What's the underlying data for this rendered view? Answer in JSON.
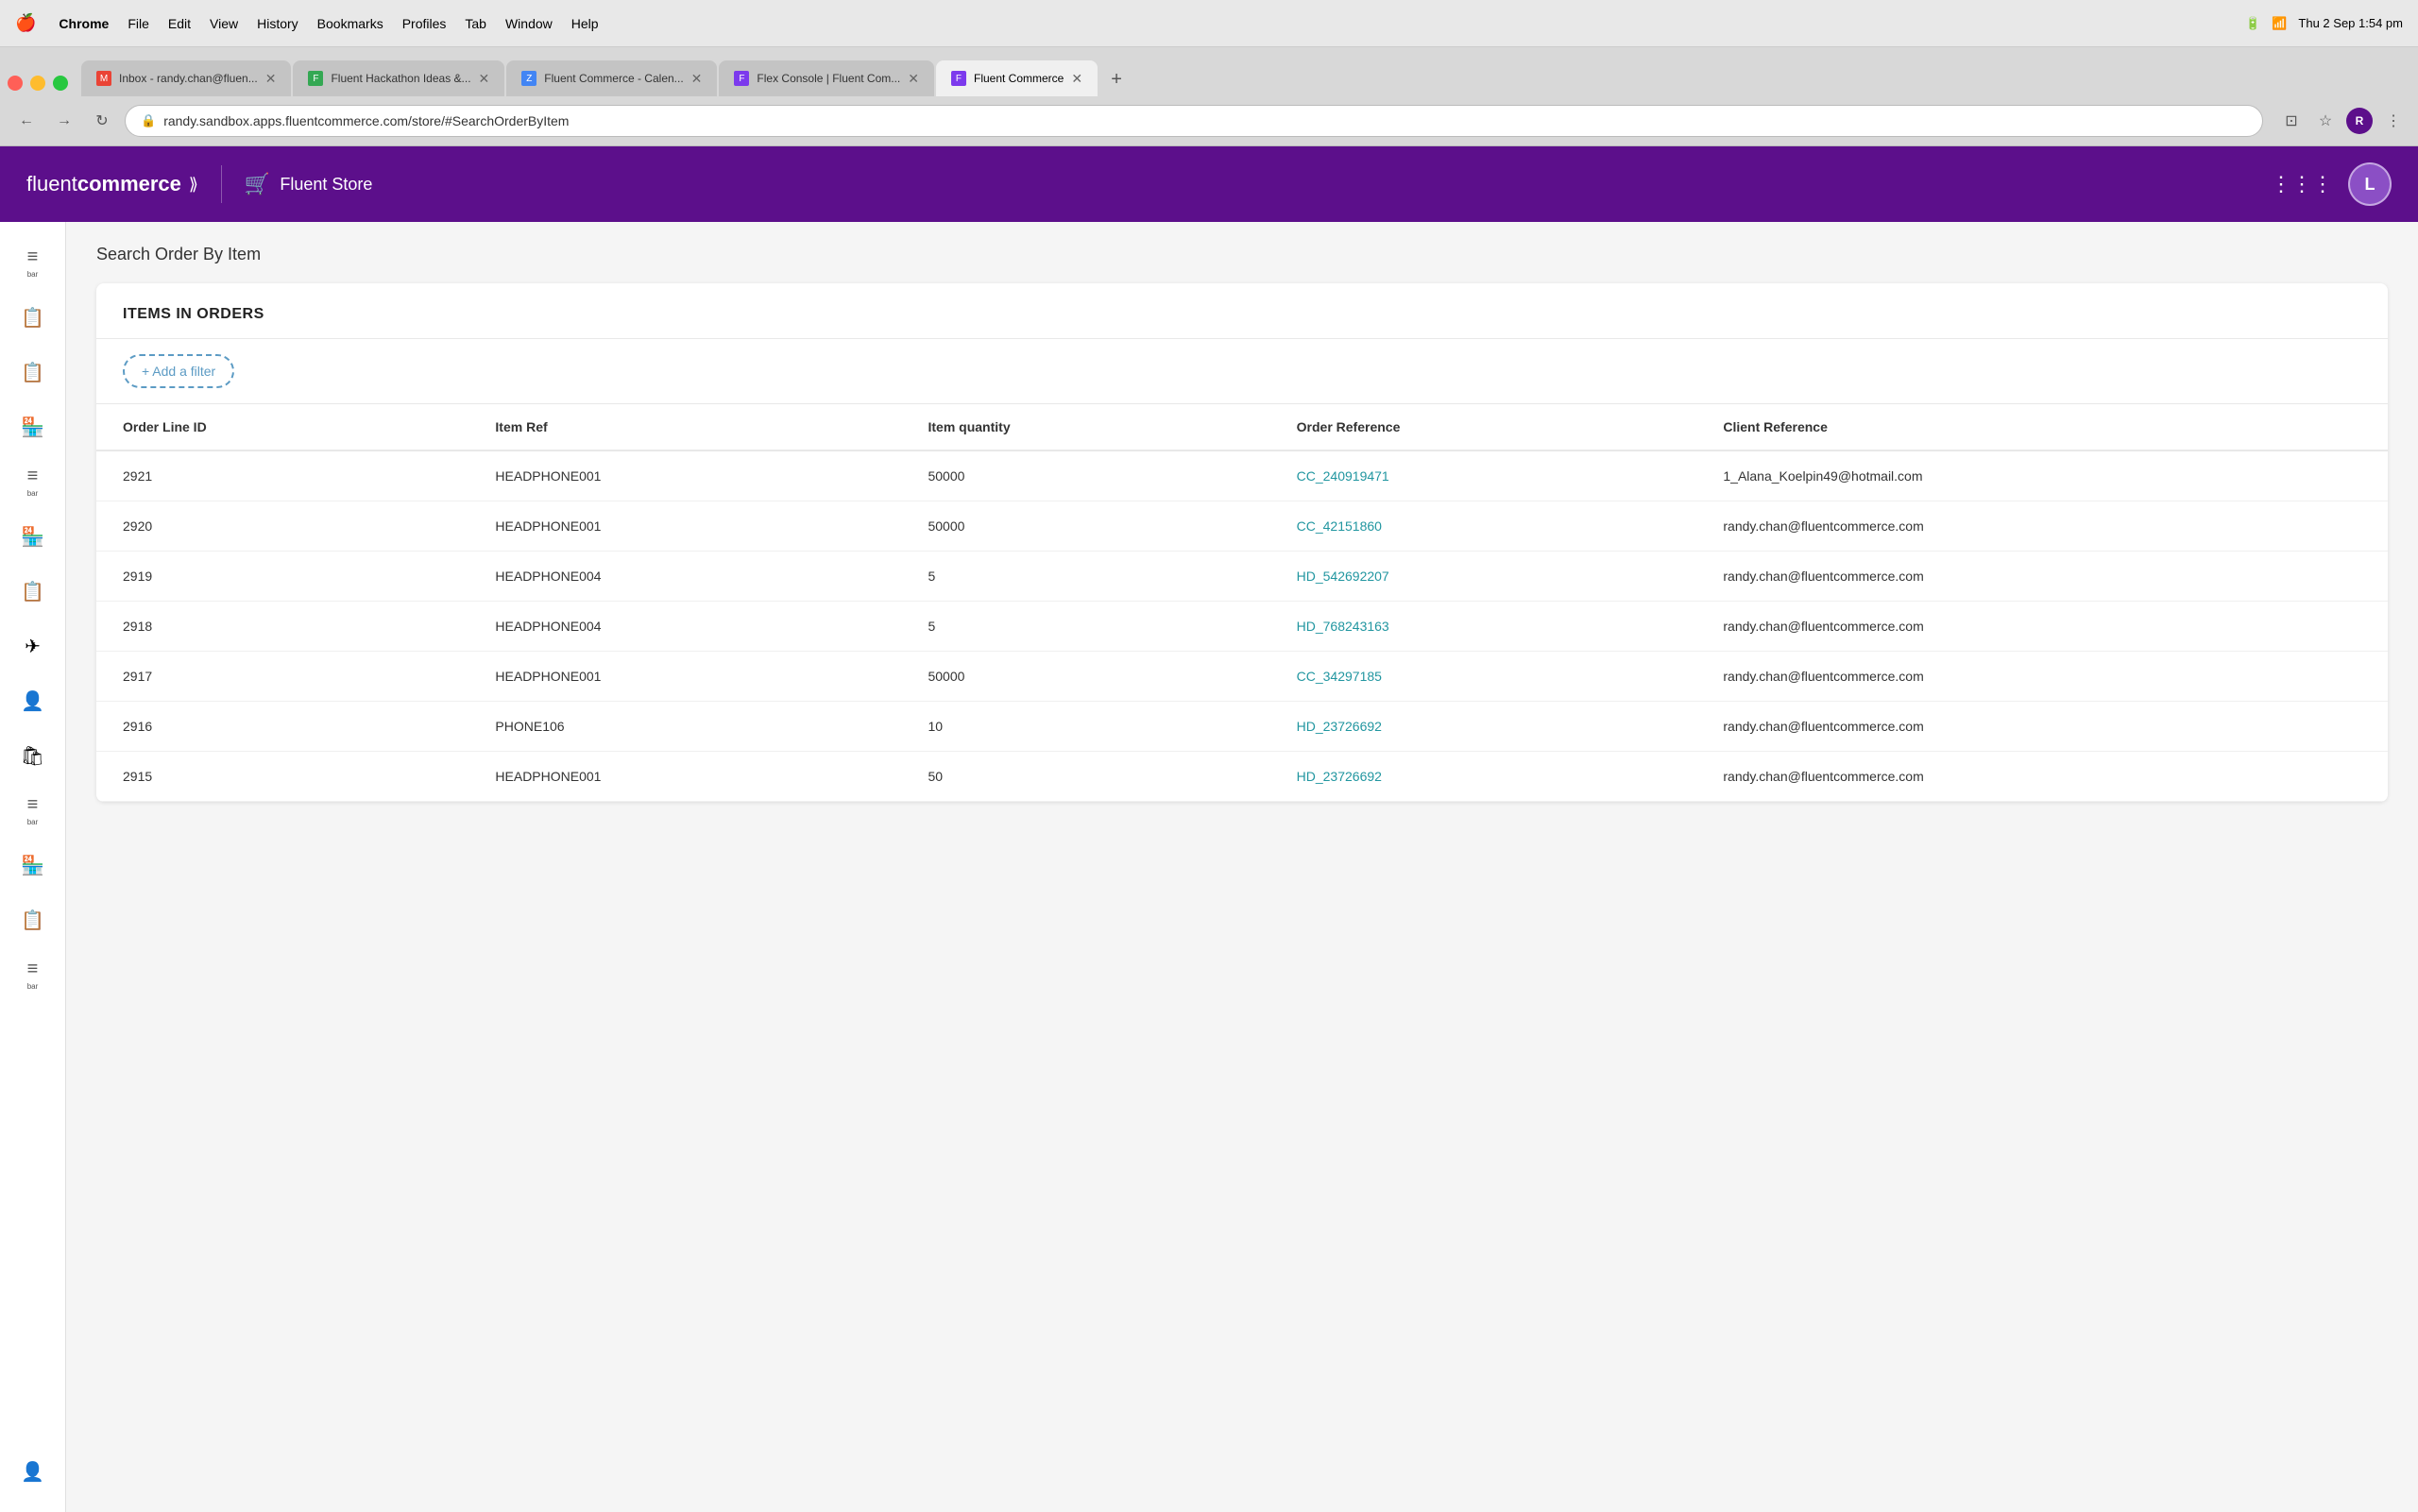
{
  "macbar": {
    "apple": "🍎",
    "items": [
      "Chrome",
      "File",
      "Edit",
      "View",
      "History",
      "Bookmarks",
      "Profiles",
      "Tab",
      "Window",
      "Help"
    ],
    "right": {
      "battery": "🔋",
      "wifi": "📶",
      "datetime": "Thu 2 Sep  1:54 pm"
    }
  },
  "tabs": [
    {
      "id": "tab1",
      "label": "Inbox - randy.chan@fluen...",
      "favicon_color": "#EA4335",
      "active": false
    },
    {
      "id": "tab2",
      "label": "Fluent Hackathon Ideas &...",
      "favicon_color": "#34A853",
      "active": false
    },
    {
      "id": "tab3",
      "label": "Fluent Commerce - Calen...",
      "favicon_color": "#4285F4",
      "active": false
    },
    {
      "id": "tab4",
      "label": "Flex Console | Fluent Com...",
      "favicon_color": "#7c3aed",
      "active": false
    },
    {
      "id": "tab5",
      "label": "Fluent Commerce",
      "favicon_color": "#7c3aed",
      "active": true
    }
  ],
  "address_bar": {
    "url": "randy.sandbox.apps.fluentcommerce.com/store/#SearchOrderByItem"
  },
  "topbar": {
    "brand": "fluent",
    "brand_bold": "commerce",
    "store_label": "Fluent Store",
    "avatar_label": "L"
  },
  "sidebar": {
    "items": [
      {
        "id": "bar1",
        "label": "bar",
        "icon": "≡"
      },
      {
        "id": "orders1",
        "label": "",
        "icon": "📋"
      },
      {
        "id": "orders2",
        "label": "",
        "icon": "📋"
      },
      {
        "id": "store1",
        "label": "",
        "icon": "🏪"
      },
      {
        "id": "bar2",
        "label": "bar",
        "icon": "≡"
      },
      {
        "id": "store2",
        "label": "",
        "icon": "🏪"
      },
      {
        "id": "orders3",
        "label": "",
        "icon": "📋"
      },
      {
        "id": "flight",
        "label": "",
        "icon": "✈"
      },
      {
        "id": "person",
        "label": "",
        "icon": "👤"
      },
      {
        "id": "bag",
        "label": "",
        "icon": "🛍"
      },
      {
        "id": "bar3",
        "label": "bar",
        "icon": "≡"
      },
      {
        "id": "store3",
        "label": "",
        "icon": "🏪"
      },
      {
        "id": "orders4",
        "label": "",
        "icon": "📋"
      },
      {
        "id": "bar4",
        "label": "bar",
        "icon": "≡"
      },
      {
        "id": "user-bottom",
        "label": "",
        "icon": "👤"
      }
    ]
  },
  "page": {
    "title": "Search Order By Item",
    "section_title": "ITEMS IN ORDERS",
    "add_filter_label": "+ Add a filter",
    "table": {
      "headers": [
        "Order Line ID",
        "Item Ref",
        "Item quantity",
        "Order Reference",
        "Client Reference"
      ],
      "rows": [
        {
          "order_line_id": "2921",
          "item_ref": "HEADPHONE001",
          "item_quantity": "50000",
          "order_reference": "CC_240919471",
          "client_reference": "1_Alana_Koelpin49@hotmail.com"
        },
        {
          "order_line_id": "2920",
          "item_ref": "HEADPHONE001",
          "item_quantity": "50000",
          "order_reference": "CC_42151860",
          "client_reference": "randy.chan@fluentcommerce.com"
        },
        {
          "order_line_id": "2919",
          "item_ref": "HEADPHONE004",
          "item_quantity": "5",
          "order_reference": "HD_542692207",
          "client_reference": "randy.chan@fluentcommerce.com"
        },
        {
          "order_line_id": "2918",
          "item_ref": "HEADPHONE004",
          "item_quantity": "5",
          "order_reference": "HD_768243163",
          "client_reference": "randy.chan@fluentcommerce.com"
        },
        {
          "order_line_id": "2917",
          "item_ref": "HEADPHONE001",
          "item_quantity": "50000",
          "order_reference": "CC_34297185",
          "client_reference": "randy.chan@fluentcommerce.com"
        },
        {
          "order_line_id": "2916",
          "item_ref": "PHONE106",
          "item_quantity": "10",
          "order_reference": "HD_23726692",
          "client_reference": "randy.chan@fluentcommerce.com"
        },
        {
          "order_line_id": "2915",
          "item_ref": "HEADPHONE001",
          "item_quantity": "50",
          "order_reference": "HD_23726692",
          "client_reference": "randy.chan@fluentcommerce.com"
        }
      ]
    }
  },
  "colors": {
    "brand_purple": "#5c0f8b",
    "link_teal": "#2196a0",
    "filter_border": "#5c9bc4"
  }
}
